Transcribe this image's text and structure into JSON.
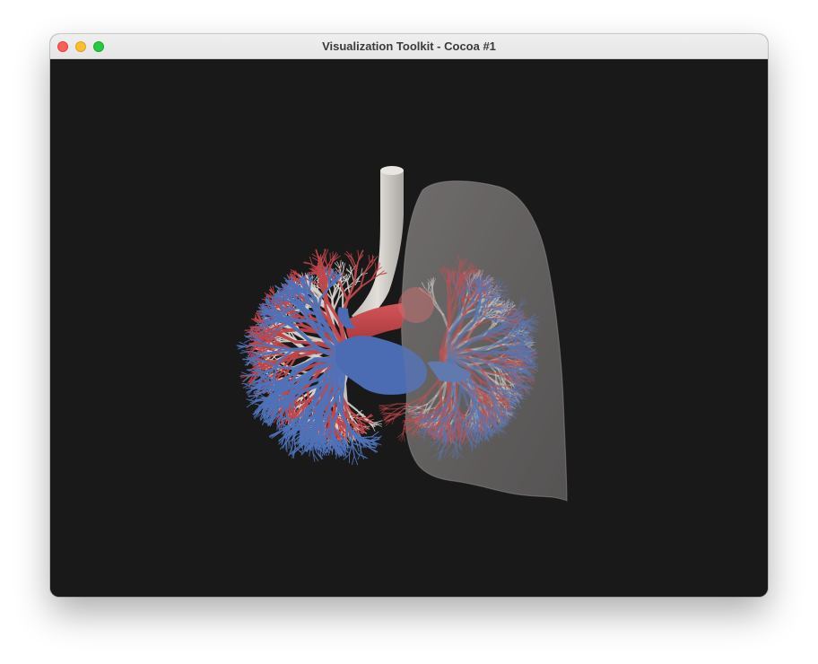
{
  "window": {
    "title": "Visualization Toolkit - Cocoa #1"
  },
  "controls": {
    "close": "close-icon",
    "minimize": "minimize-icon",
    "zoom": "zoom-icon"
  },
  "scene": {
    "background_color": "#191919",
    "artery_color": "#c0474a",
    "vein_color": "#4f72b8",
    "airway_color": "#d6d2cc",
    "lung_color": "#8a8686"
  }
}
